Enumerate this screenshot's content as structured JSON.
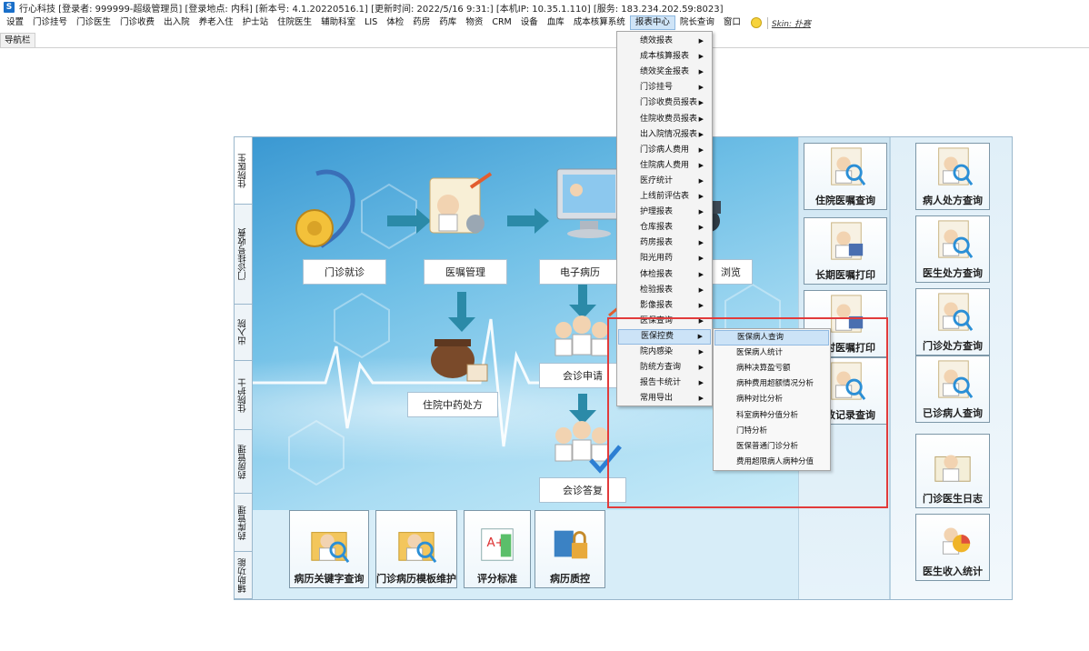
{
  "titlebar": {
    "logo": "S",
    "text": "行心科技 [登录者: 999999-超级管理员] [登录地点: 内科] [新本号: 4.1.20220516.1] [更新时间: 2022/5/16 9:31:] [本机IP: 10.35.1.110] [服务: 183.234.202.59:8023]"
  },
  "menubar": {
    "items": [
      "设置",
      "门诊挂号",
      "门诊医生",
      "门诊收费",
      "出入院",
      "养老入住",
      "护士站",
      "住院医生",
      "辅助科室",
      "LIS",
      "体检",
      "药房",
      "药库",
      "物资",
      "CRM",
      "设备",
      "血库",
      "成本核算系统",
      "报表中心",
      "院长查询",
      "窗口"
    ],
    "active": "报表中心",
    "skin": "Skin: 扑赛"
  },
  "nav": {
    "tab": "导航栏"
  },
  "vtabs": [
    "住院医生",
    "门诊挂号收费",
    "出入院",
    "住院护士",
    "药房管理",
    "药库管理",
    "辅助功能"
  ],
  "flow": {
    "outpatient": "门诊就诊",
    "orders": "医嘱管理",
    "emr": "电子病历",
    "browse": "浏览",
    "tcm": "住院中药处方",
    "consult_apply": "会诊申请",
    "consult_reply": "会诊答复"
  },
  "mid_tiles": [
    "住院医嘱查询",
    "长期医嘱打印",
    "临时医嘱打印",
    "修改记录查询"
  ],
  "right_tiles": [
    "病人处方查询",
    "医生处方查询",
    "门诊处方查询",
    "已诊病人查询",
    "门诊医生日志",
    "医生收入统计"
  ],
  "bottom_tiles": [
    "病历关键字查询",
    "门诊病历模板维护",
    "评分标准",
    "病历质控"
  ],
  "dropdown": {
    "items": [
      "绩效报表",
      "成本核算报表",
      "绩效奖金报表",
      "门诊挂号",
      "门诊收费员报表",
      "住院收费员报表",
      "出入院情况报表",
      "门诊病人费用",
      "住院病人费用",
      "医疗统计",
      "上线前评估表",
      "护理报表",
      "仓库报表",
      "药房报表",
      "阳光用药",
      "体检报表",
      "检验报表",
      "影像报表",
      "医保查询",
      "医保控费",
      "院内感染",
      "防统方查询",
      "报告卡统计",
      "常用导出"
    ],
    "highlighted": "医保控费"
  },
  "submenu": {
    "items": [
      "医保病人查询",
      "医保病人统计",
      "病种决算盈亏额",
      "病种费用超额情况分析",
      "病种对比分析",
      "科室病种分值分析",
      "门特分析",
      "医保普通门诊分析",
      "费用超限病人病种分值"
    ],
    "highlighted": "医保病人查询"
  }
}
